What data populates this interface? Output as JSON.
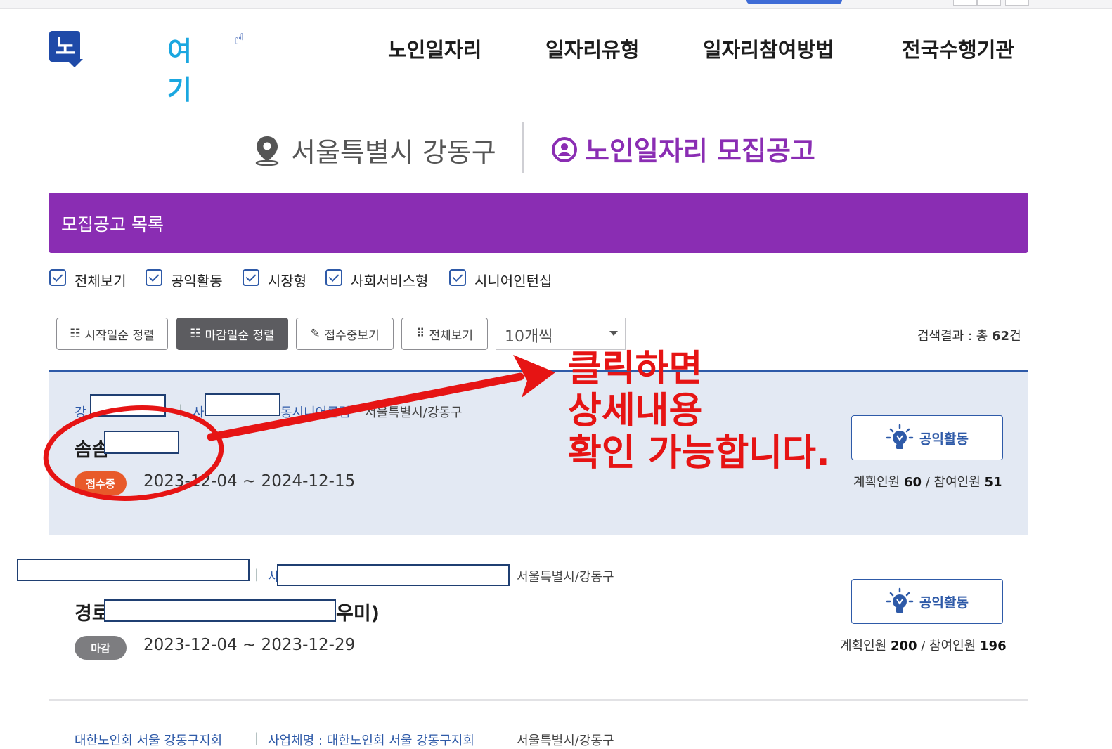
{
  "header": {
    "logo_main": "노인일자리",
    "logo_accent": "여기",
    "nav": [
      {
        "label": "노인일자리"
      },
      {
        "label": "일자리유형"
      },
      {
        "label": "일자리참여방법"
      },
      {
        "label": "전국수행기관"
      }
    ]
  },
  "location": {
    "region": "서울특별시 강동구",
    "title": "노인일자리 모집공고"
  },
  "banner": {
    "title": "모집공고 목록"
  },
  "filters": [
    {
      "label": "전체보기",
      "checked": true
    },
    {
      "label": "공익활동",
      "checked": true
    },
    {
      "label": "시장형",
      "checked": true
    },
    {
      "label": "사회서비스형",
      "checked": true
    },
    {
      "label": "시니어인턴십",
      "checked": true
    }
  ],
  "toolbar": {
    "sort_start": "시작일순 정렬",
    "sort_end": "마감일순 정렬",
    "open_only": "접수중보기",
    "view_all": "전체보기",
    "page_size": "10개씩",
    "result_prefix": "검색결과 : 총 ",
    "result_count": "62",
    "result_suffix": "건"
  },
  "listings": [
    {
      "org_prefix": "강",
      "business_prefix": "사",
      "business_suffix": "동시니어클럽",
      "region": "서울특별시/강동구",
      "title": "솜솜",
      "status": "접수중",
      "period": "2023-12-04 ~ 2024-12-15",
      "type": "공익활동",
      "planned_label": "계획인원 ",
      "planned": "60",
      "participants_label": " / 참여인원 ",
      "participants": "51"
    },
    {
      "business_prefix": "사",
      "region": "서울특별시/강동구",
      "title_prefix": "경로",
      "title_suffix": "우미)",
      "status": "마감",
      "period": "2023-12-04 ~ 2023-12-29",
      "type": "공익활동",
      "planned_label": "계획인원 ",
      "planned": "200",
      "participants_label": " / 참여인원 ",
      "participants": "196"
    },
    {
      "org": "대한노인회 서울 강동구지회",
      "business": "사업체명 : 대한노인회 서울 강동구지회",
      "region": "서울특별시/강동구"
    }
  ],
  "annotation": {
    "lines": [
      "클릭하면",
      "상세내용",
      "확인 가능합니다."
    ],
    "color": "#e61414"
  },
  "colors": {
    "brand_purple": "#8a2db3",
    "brand_blue": "#2e5aa8",
    "status_open": "#e85a2a",
    "status_closed": "#7d7d80"
  }
}
